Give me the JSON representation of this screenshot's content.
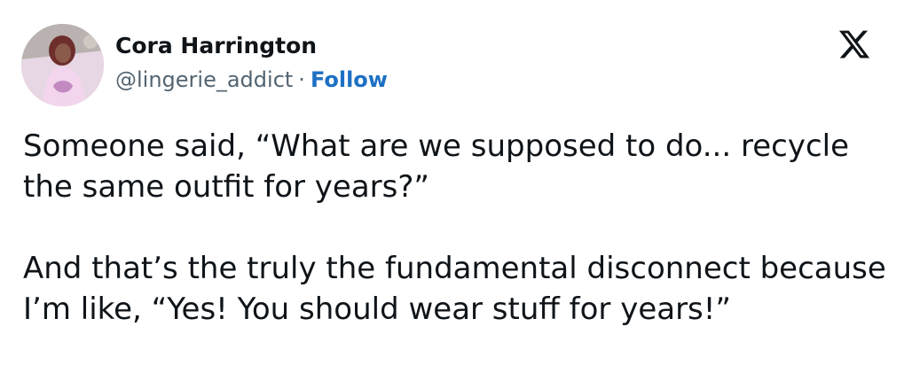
{
  "author": {
    "name": "Cora Harrington",
    "handle": "@lingerie_addict",
    "separator": "·",
    "follow_label": "Follow"
  },
  "icons": {
    "avatar": "profile-photo",
    "brand": "x-logo-icon"
  },
  "tweet": {
    "paragraphs": [
      "Someone said, “What are we supposed to do... recycle the same outfit for years?”",
      "And that’s the truly the fundamental disconnect because I’m like, “Yes! You should wear stuff for years!”"
    ]
  },
  "colors": {
    "text": "#0f1419",
    "secondary": "#536471",
    "link": "#1d70c4",
    "background": "#ffffff"
  }
}
